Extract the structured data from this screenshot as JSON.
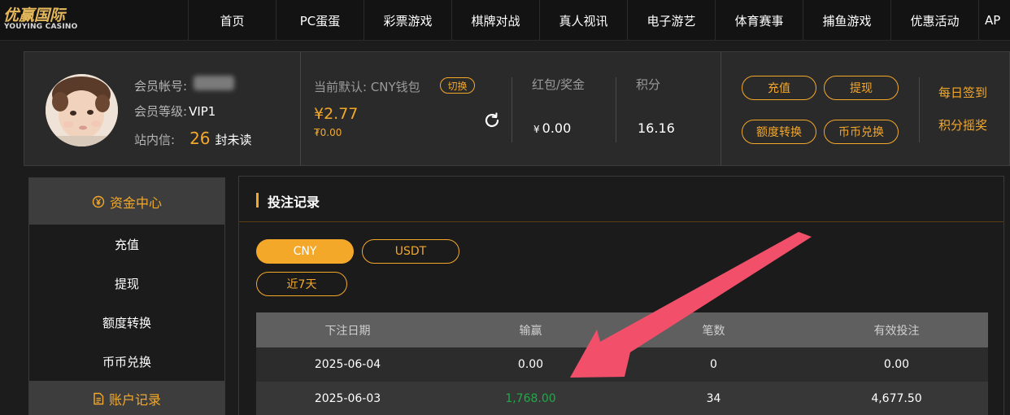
{
  "nav": {
    "logo_cn": "优赢国际",
    "logo_en": "YOUYING CASINO",
    "items": [
      "首页",
      "PC蛋蛋",
      "彩票游戏",
      "棋牌对战",
      "真人视讯",
      "电子游艺",
      "体育赛事",
      "捕鱼游戏",
      "优惠活动",
      "AP"
    ]
  },
  "account": {
    "member_id_label": "会员帐号:",
    "level_label": "会员等级:",
    "level_value": "VIP1",
    "message_label": "站内信:",
    "message_count": "26",
    "message_unit": "封未读",
    "wallet_label": "当前默认: CNY钱包",
    "switch_label": "切换",
    "wallet_amount": "¥2.77",
    "wallet_sub": "₮0.00",
    "redpacket_label": "红包/奖金",
    "redpacket_currency": "¥",
    "redpacket_value": "0.00",
    "points_label": "积分",
    "points_value": "16.16",
    "buttons": [
      "充值",
      "提现",
      "额度转换",
      "币币兑换"
    ],
    "links": [
      "每日签到",
      "积分摇奖"
    ]
  },
  "sidebar": {
    "section1": "资金中心",
    "items": [
      "充值",
      "提现",
      "额度转换",
      "币币兑换"
    ],
    "section2": "账户记录"
  },
  "main": {
    "title": "投注记录",
    "currency_tabs": [
      "CNY",
      "USDT"
    ],
    "period": "近7天",
    "columns": [
      "下注日期",
      "输赢",
      "笔数",
      "有效投注"
    ],
    "rows": [
      [
        "2025-06-04",
        "0.00",
        "0",
        "0.00"
      ],
      [
        "2025-06-03",
        "1,768.00",
        "34",
        "4,677.50"
      ]
    ]
  },
  "colors": {
    "accent": "#f4a82a",
    "win": "#22a84a",
    "arrow": "#f2506a"
  }
}
